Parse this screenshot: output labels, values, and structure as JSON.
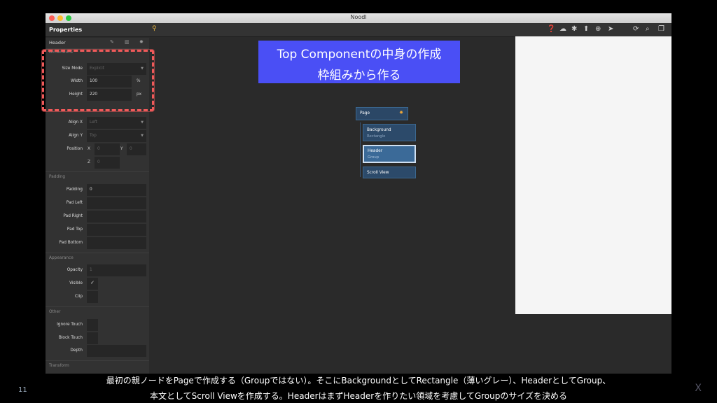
{
  "window": {
    "title": "Noodl"
  },
  "toolbar": {
    "title": "Properties",
    "node_icon": "⚲",
    "icons": [
      "help-icon",
      "cloud-icon",
      "bug-icon",
      "upload-icon",
      "publish-icon",
      "send-icon",
      "refresh-icon",
      "search-icon",
      "window-icon"
    ]
  },
  "panel": {
    "header_title": "Header",
    "sections": {
      "dimensions": "Dimensions",
      "padding": "Padding",
      "appearance": "Appearance",
      "other": "Other",
      "transform": "Transform"
    },
    "size_mode": {
      "label": "Size Mode",
      "value": "Explicit"
    },
    "width": {
      "label": "Width",
      "value": "100",
      "unit": "%"
    },
    "height": {
      "label": "Height",
      "value": "220",
      "unit": "px"
    },
    "align_x": {
      "label": "Align X",
      "value": "Left"
    },
    "align_y": {
      "label": "Align Y",
      "value": "Top"
    },
    "position": {
      "label": "Position",
      "x_label": "X",
      "x_value": "0",
      "y_label": "Y",
      "y_value": "0",
      "z_label": "Z",
      "z_value": "0"
    },
    "padding": {
      "label": "Padding",
      "value": "0"
    },
    "pad_left": {
      "label": "Pad Left"
    },
    "pad_right": {
      "label": "Pad Right"
    },
    "pad_top": {
      "label": "Pad Top"
    },
    "pad_bottom": {
      "label": "Pad Bottom"
    },
    "opacity": {
      "label": "Opacity",
      "value": "1"
    },
    "visible": {
      "label": "Visible",
      "check": "✓"
    },
    "clip": {
      "label": "Clip"
    },
    "ignore_touch": {
      "label": "Ignore Touch"
    },
    "block_touch": {
      "label": "Block Touch"
    },
    "depth": {
      "label": "Depth"
    }
  },
  "banner": {
    "line1": "Top Componentの中身の作成",
    "line2": "枠組みから作る"
  },
  "nodes": {
    "page": {
      "title": "Page"
    },
    "background": {
      "title": "Background",
      "type": "Rectangle"
    },
    "header": {
      "title": "Header",
      "type": "Group"
    },
    "scroll": {
      "title": "Scroll View"
    }
  },
  "caption": {
    "line1": "最初の親ノードをPageで作成する（Groupではない）。そこにBackgroundとしてRectangle（薄いグレー）、HeaderとしてGroup、",
    "line2": "本文としてScroll Viewを作成する。HeaderはまずHeaderを作りたい領域を考慮してGroupのサイズを決める"
  },
  "slide_number": "11",
  "close_label": "X"
}
